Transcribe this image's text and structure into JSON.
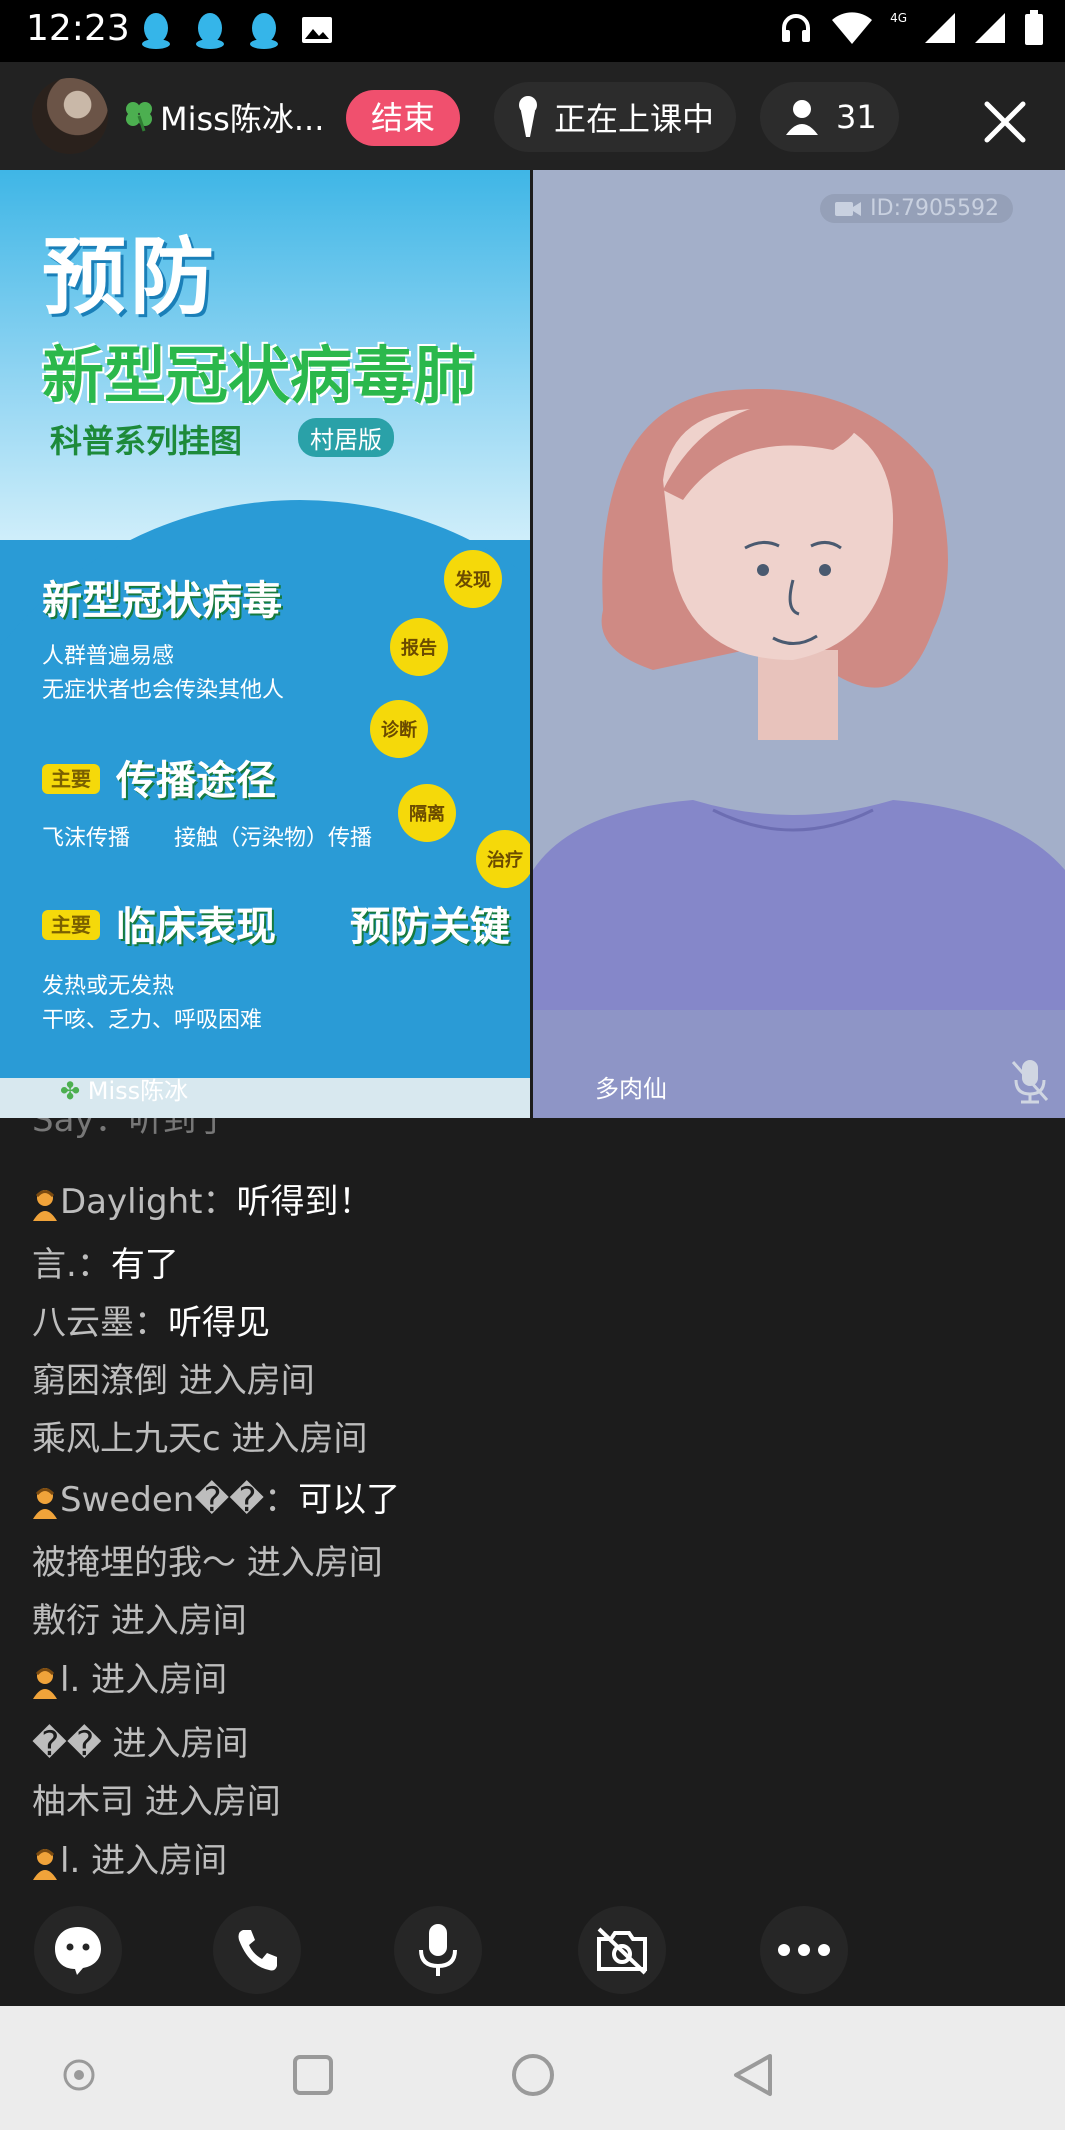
{
  "status_bar": {
    "time": "12:23",
    "network": "4G",
    "sim": "1X",
    "left_icons": [
      "qq-icon",
      "qq-icon",
      "qq-icon",
      "image-icon"
    ],
    "right_icons": [
      "headset-icon",
      "wifi-icon",
      "signal-icon",
      "signal-icon",
      "battery-icon"
    ]
  },
  "header": {
    "host_name": "Miss陈冰...",
    "end_button": "结束",
    "class_status": "正在上课中",
    "viewer_count": "31"
  },
  "videos": {
    "left": {
      "poster_title": "预防",
      "poster_subtitle": "新型冠状病毒肺",
      "poster_series": "科普系列挂图",
      "poster_badge": "村居版",
      "section_virus": "新型冠状病毒",
      "virus_line1": "人群普遍易感",
      "virus_line2": "无症状者也会传染其他人",
      "section_spread": "传播途径",
      "spread_line": "飞沫传播　　接触（污染物）传播",
      "section_clinical": "临床表现",
      "section_prevent": "预防关键",
      "clinical_line1": "发热或无发热",
      "clinical_line2": "干咳、乏力、呼吸困难",
      "tag_main": "主要",
      "circle_labels": [
        "发现",
        "报告",
        "诊断",
        "隔离",
        "治疗"
      ],
      "participant_name": "Miss陈冰"
    },
    "right": {
      "room_id": "ID:7905592",
      "participant_name": "多肉仙"
    }
  },
  "chat": {
    "partial_top": "Say：听到了",
    "messages": [
      {
        "user": "Daylight",
        "sep": "：",
        "text": "听得到！",
        "has_icon": true
      },
      {
        "user": "言.",
        "sep": "：",
        "text": "有了",
        "has_icon": false
      },
      {
        "user": "八云墨",
        "sep": "：",
        "text": "听得见",
        "has_icon": false
      },
      {
        "user": "窮困潦倒",
        "sep": " ",
        "text": "进入房间",
        "has_icon": false,
        "system": true
      },
      {
        "user": "乘风上九天c",
        "sep": " ",
        "text": "进入房间",
        "has_icon": false,
        "system": true
      },
      {
        "user": "Sweden��",
        "sep": "：",
        "text": "可以了",
        "has_icon": true
      },
      {
        "user": "被掩埋的我～",
        "sep": " ",
        "text": "进入房间",
        "has_icon": false,
        "system": true
      },
      {
        "user": "敷衍",
        "sep": " ",
        "text": "进入房间",
        "has_icon": false,
        "system": true
      },
      {
        "user": "l.",
        "sep": " ",
        "text": "进入房间",
        "has_icon": true,
        "system": true
      },
      {
        "user": "��",
        "sep": " ",
        "text": "进入房间",
        "has_icon": false,
        "system": true
      },
      {
        "user": "柚木司",
        "sep": " ",
        "text": "进入房间",
        "has_icon": false,
        "system": true
      },
      {
        "user": "l.",
        "sep": " ",
        "text": "进入房间",
        "has_icon": true,
        "system": true
      }
    ]
  },
  "toolbar": [
    "emoji-icon",
    "phone-icon",
    "microphone-icon",
    "camera-off-icon",
    "more-icon"
  ],
  "nav": [
    "record-icon",
    "recent-apps-icon",
    "home-icon",
    "back-icon"
  ],
  "colors": {
    "end_button": "#f0506e",
    "background": "#1c1c1c",
    "system_text": "#bdbdbd",
    "message_text": "#ffffff"
  }
}
